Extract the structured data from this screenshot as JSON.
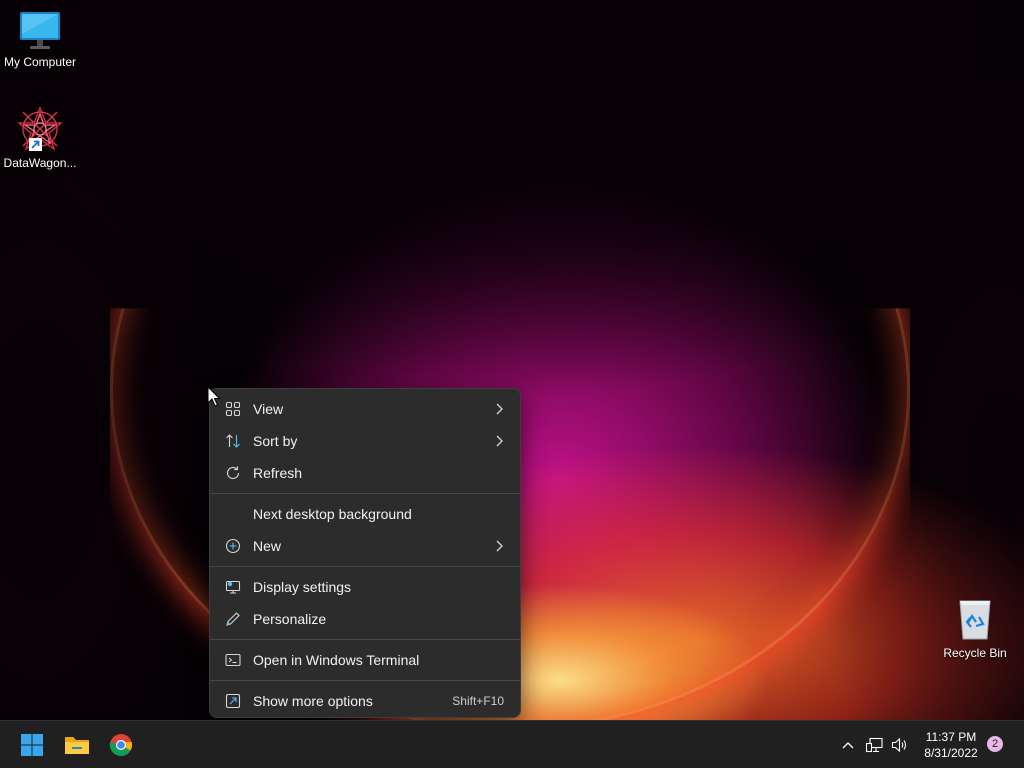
{
  "desktop": {
    "icons": [
      {
        "label": "My Computer",
        "icon": "monitor-icon"
      },
      {
        "label": "DataWagon...",
        "icon": "datawagon-app-icon",
        "shortcut_overlay": "shortcut-arrow-icon"
      },
      {
        "label": "Recycle Bin",
        "icon": "recycle-bin-icon"
      }
    ]
  },
  "context_menu": {
    "groups": [
      [
        {
          "label": "View",
          "icon": "grid-view-icon",
          "submenu": true
        },
        {
          "label": "Sort by",
          "icon": "sort-icon",
          "submenu": true
        },
        {
          "label": "Refresh",
          "icon": "refresh-icon",
          "submenu": false
        }
      ],
      [
        {
          "label": "Next desktop background",
          "icon": "",
          "submenu": false
        },
        {
          "label": "New",
          "icon": "add-circle-icon",
          "submenu": true
        }
      ],
      [
        {
          "label": "Display settings",
          "icon": "display-settings-icon",
          "submenu": false
        },
        {
          "label": "Personalize",
          "icon": "pen-icon",
          "submenu": false
        }
      ],
      [
        {
          "label": "Open in Windows Terminal",
          "icon": "terminal-icon",
          "submenu": false
        }
      ],
      [
        {
          "label": "Show more options",
          "icon": "more-options-icon",
          "submenu": false,
          "shortcut": "Shift+F10"
        }
      ]
    ]
  },
  "taskbar": {
    "pinned": [
      {
        "name": "Start",
        "icon": "windows-logo-icon"
      },
      {
        "name": "File Explorer",
        "icon": "folder-icon"
      },
      {
        "name": "Google Chrome",
        "icon": "chrome-icon"
      }
    ],
    "tray": {
      "icons": [
        "chevron-up-icon",
        "network-icon",
        "volume-icon"
      ],
      "time": "11:37 PM",
      "date": "8/31/2022",
      "notification_count": "2"
    }
  },
  "colors": {
    "menu_bg": "#2c2c2c",
    "taskbar_bg": "#202020",
    "accent_blue": "#4cc2ff",
    "notification_badge": "#e7b8e6"
  }
}
